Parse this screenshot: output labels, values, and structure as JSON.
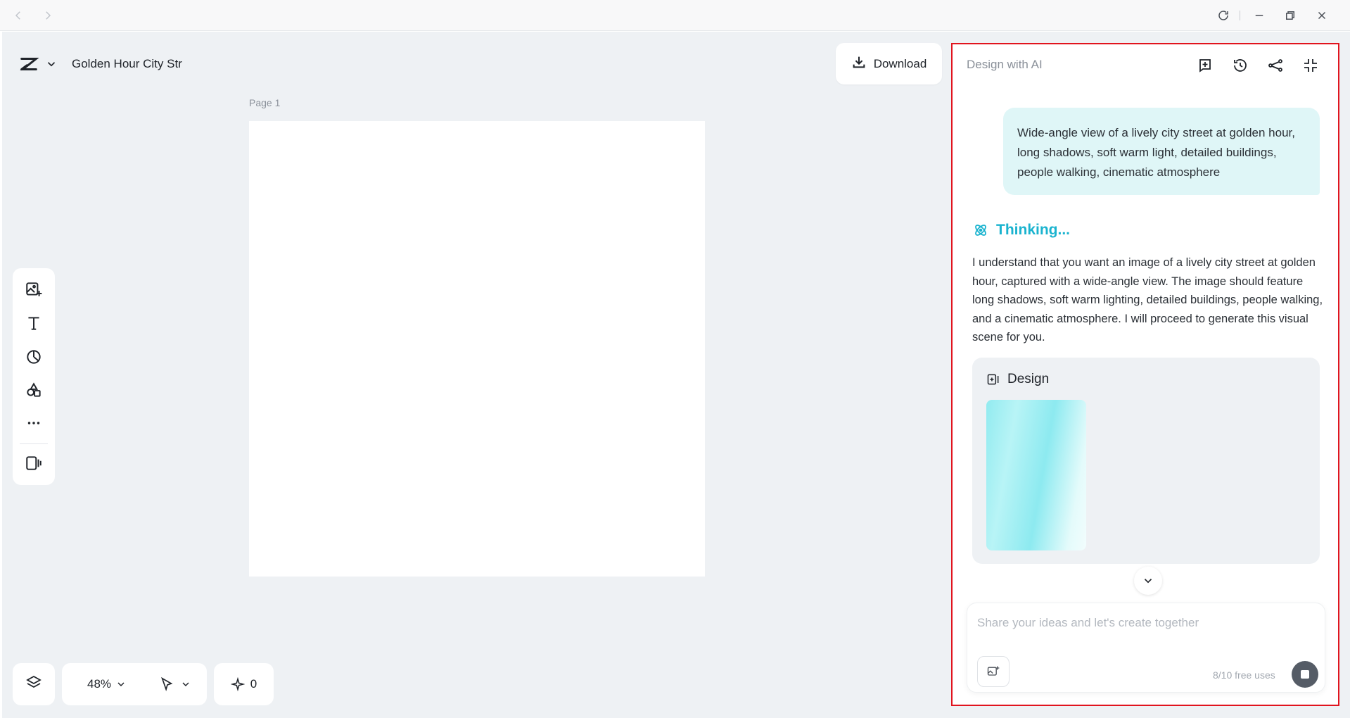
{
  "project": {
    "title": "Golden Hour City Str"
  },
  "header": {
    "download_label": "Download"
  },
  "canvas": {
    "page_label": "Page 1"
  },
  "bottom": {
    "zoom": "48%",
    "credits": "0"
  },
  "ai": {
    "title": "Design with AI",
    "user_message": "Wide-angle view of a lively city street at golden hour, long shadows, soft warm light, detailed buildings, people walking, cinematic atmosphere",
    "status": "Thinking...",
    "reply": "I understand that you want an image of a lively city street at golden hour, captured with a wide-angle view. The image should feature long shadows, soft warm lighting, detailed buildings, people walking, and a cinematic atmosphere. I will proceed to generate this visual scene for you.",
    "design_label": "Design",
    "input_placeholder": "Share your ideas and let's create together",
    "usage": "8/10 free uses"
  },
  "colors": {
    "accent": "#1ab3cf",
    "panel_border": "#e1141e",
    "bubble": "#dff6f7",
    "workspace": "#eef1f4"
  },
  "icons": {
    "titlebar": [
      "back-arrow-icon",
      "forward-arrow-icon",
      "refresh-icon",
      "minimize-icon",
      "restore-icon",
      "close-icon"
    ],
    "tools": [
      "add-image-icon",
      "text-icon",
      "shape-icon",
      "elements-icon",
      "more-icon",
      "present-icon"
    ],
    "ai_header": [
      "new-chat-icon",
      "history-icon",
      "share-icon",
      "collapse-icon"
    ]
  }
}
